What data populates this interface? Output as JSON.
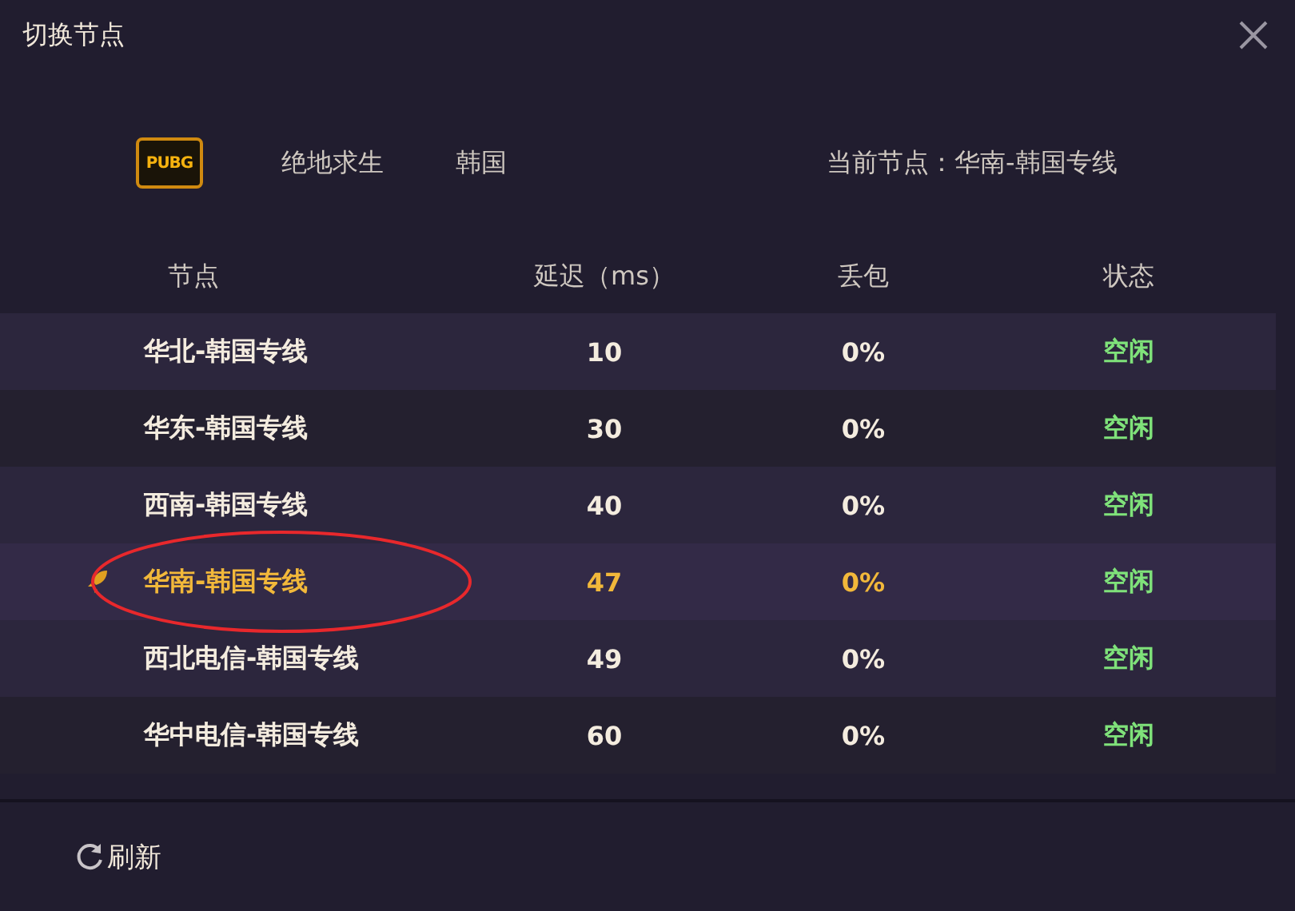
{
  "window": {
    "title": "切换节点"
  },
  "game": {
    "logo_text": "PUBG",
    "name": "绝地求生",
    "region": "韩国",
    "current_node": "当前节点：华南-韩国专线"
  },
  "table": {
    "columns": [
      "节点",
      "延迟（ms）",
      "丢包",
      "状态"
    ],
    "rows": [
      {
        "node": "华北-韩国专线",
        "latency": "10",
        "loss": "0%",
        "status": "空闲",
        "selected": false,
        "circled": false
      },
      {
        "node": "华东-韩国专线",
        "latency": "30",
        "loss": "0%",
        "status": "空闲",
        "selected": false,
        "circled": false
      },
      {
        "node": "西南-韩国专线",
        "latency": "40",
        "loss": "0%",
        "status": "空闲",
        "selected": false,
        "circled": false
      },
      {
        "node": "华南-韩国专线",
        "latency": "47",
        "loss": "0%",
        "status": "空闲",
        "selected": true,
        "circled": true
      },
      {
        "node": "西北电信-韩国专线",
        "latency": "49",
        "loss": "0%",
        "status": "空闲",
        "selected": false,
        "circled": false
      },
      {
        "node": "华中电信-韩国专线",
        "latency": "60",
        "loss": "0%",
        "status": "空闲",
        "selected": false,
        "circled": false
      }
    ]
  },
  "footer": {
    "refresh": "刷新"
  }
}
